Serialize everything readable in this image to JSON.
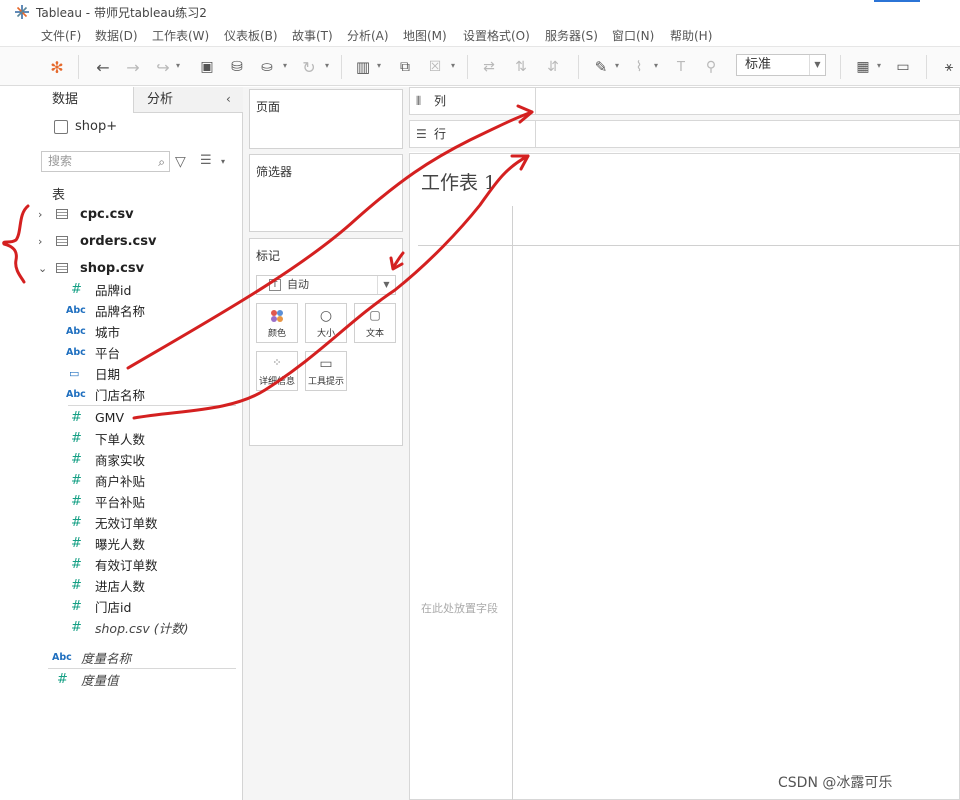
{
  "window": {
    "title": "Tableau - 带师兄tableau练习2"
  },
  "menu": [
    "文件(F)",
    "数据(D)",
    "工作表(W)",
    "仪表板(B)",
    "故事(T)",
    "分析(A)",
    "地图(M)",
    "设置格式(O)",
    "服务器(S)",
    "窗口(N)",
    "帮助(H)"
  ],
  "toolbar": {
    "icons": [
      "tableau-logo-icon",
      "undo-icon",
      "redo-icon",
      "replay-icon",
      "save-icon",
      "new-datasource-icon",
      "pause-update-icon",
      "refresh-icon",
      "new-worksheet-icon",
      "duplicate-icon",
      "clear-icon",
      "swap-icon",
      "sort-ascending-icon",
      "sort-descending-icon",
      "highlight-icon",
      "attach-icon",
      "labels-icon",
      "pin-icon",
      "show-me-icon",
      "presentation-icon",
      "share-icon"
    ],
    "fit_select": "标准"
  },
  "left_pane": {
    "tabs": {
      "data": "数据",
      "analysis": "分析"
    },
    "collapse_glyph": "‹",
    "datasource": "shop+",
    "search_placeholder": "搜索",
    "tables_heading": "表",
    "tables": [
      {
        "name": "cpc.csv",
        "expanded": false
      },
      {
        "name": "orders.csv",
        "expanded": false
      },
      {
        "name": "shop.csv",
        "expanded": true
      }
    ],
    "fields": [
      {
        "type": "measure",
        "icon": "#",
        "name": "品牌id"
      },
      {
        "type": "dimension",
        "icon": "Abc",
        "name": "品牌名称"
      },
      {
        "type": "dimension",
        "icon": "Abc",
        "name": "城市"
      },
      {
        "type": "dimension",
        "icon": "Abc",
        "name": "平台"
      },
      {
        "type": "date",
        "icon": "date-icon",
        "name": "日期"
      },
      {
        "type": "dimension",
        "icon": "Abc",
        "name": "门店名称"
      },
      {
        "type": "measure",
        "icon": "#",
        "name": "GMV"
      },
      {
        "type": "measure",
        "icon": "#",
        "name": "下单人数"
      },
      {
        "type": "measure",
        "icon": "#",
        "name": "商家实收"
      },
      {
        "type": "measure",
        "icon": "#",
        "name": "商户补贴"
      },
      {
        "type": "measure",
        "icon": "#",
        "name": "平台补贴"
      },
      {
        "type": "measure",
        "icon": "#",
        "name": "无效订单数"
      },
      {
        "type": "measure",
        "icon": "#",
        "name": "曝光人数"
      },
      {
        "type": "measure",
        "icon": "#",
        "name": "有效订单数"
      },
      {
        "type": "measure",
        "icon": "#",
        "name": "进店人数"
      },
      {
        "type": "measure",
        "icon": "#",
        "name": "门店id"
      },
      {
        "type": "measure",
        "icon": "#",
        "name": "shop.csv (计数)"
      }
    ],
    "extra_fields": [
      {
        "icon": "Abc",
        "name": "度量名称"
      },
      {
        "icon": "#",
        "name": "度量值"
      }
    ]
  },
  "cards": {
    "pages": "页面",
    "filters": "筛选器",
    "marks": "标记",
    "marks_type": "自动",
    "mark_buttons": {
      "color": "颜色",
      "size": "大小",
      "text": "文本",
      "detail": "详细信息",
      "tooltip": "工具提示"
    }
  },
  "shelves": {
    "columns": "列",
    "rows": "行"
  },
  "view": {
    "sheet_title": "工作表 1",
    "drop_hint": "在此处放置字段"
  },
  "annotation_color": "#d42020",
  "watermark": "CSDN @冰露可乐"
}
